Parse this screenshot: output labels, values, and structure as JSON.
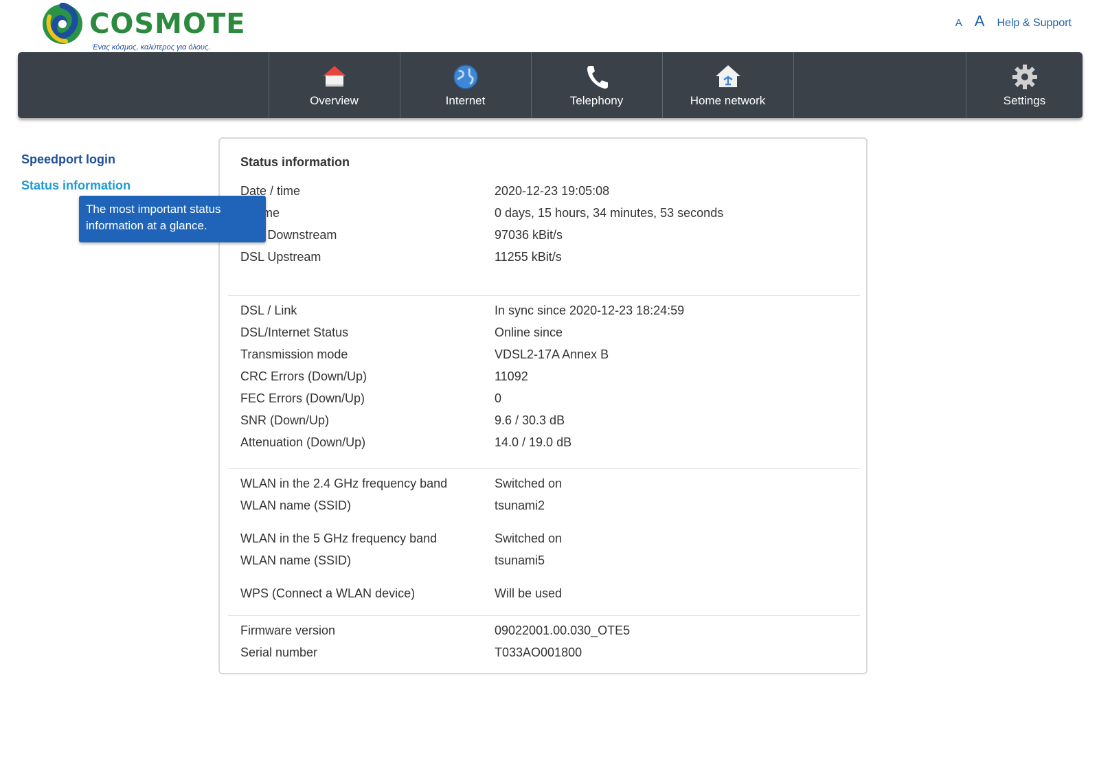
{
  "brand": {
    "name": "COSMOTE",
    "tagline": "Ένας κόσμος, καλύτερος για όλους."
  },
  "top_links": {
    "font_small": "A",
    "font_large": "A",
    "help": "Help & Support"
  },
  "nav": {
    "overview": "Overview",
    "internet": "Internet",
    "telephony": "Telephony",
    "home_network": "Home network",
    "settings": "Settings"
  },
  "sidebar": {
    "login": "Speedport login",
    "status": "Status information",
    "tooltip": "The most important status information at a glance."
  },
  "panel": {
    "title": "Status information",
    "rows": [
      {
        "label": "Date / time",
        "value": "2020-12-23 19:05:08"
      },
      {
        "label": "Uptime",
        "value": "0 days, 15 hours, 34 minutes, 53 seconds"
      },
      {
        "label": "DSL Downstream",
        "value": "97036 kBit/s"
      },
      {
        "label": "DSL Upstream",
        "value": "11255 kBit/s"
      },
      {
        "label": "DSL / Link",
        "value": "In sync since 2020-12-23 18:24:59"
      },
      {
        "label": "DSL/Internet Status",
        "value": "Online since"
      },
      {
        "label": "Transmission mode",
        "value": "VDSL2-17A Annex B"
      },
      {
        "label": "CRC Errors (Down/Up)",
        "value": "11092"
      },
      {
        "label": "FEC Errors (Down/Up)",
        "value": "0"
      },
      {
        "label": "SNR (Down/Up)",
        "value": "9.6 / 30.3 dB"
      },
      {
        "label": "Attenuation (Down/Up)",
        "value": "14.0 / 19.0 dB"
      },
      {
        "label": "WLAN in the 2.4 GHz frequency band",
        "value": "Switched on"
      },
      {
        "label": "WLAN name (SSID)",
        "value": "tsunami2"
      },
      {
        "label": "WLAN in the 5 GHz frequency band",
        "value": "Switched on"
      },
      {
        "label": "WLAN name (SSID)",
        "value": "tsunami5"
      },
      {
        "label": "WPS (Connect a WLAN device)",
        "value": "Will be used"
      },
      {
        "label": "Firmware version",
        "value": "09022001.00.030_OTE5"
      },
      {
        "label": "Serial number",
        "value": "T033AO001800"
      }
    ]
  },
  "colors": {
    "navbar": "#3a4148",
    "link_dark": "#1f4f9a",
    "link_active": "#1e9ad6",
    "tooltip": "#1f64b8",
    "brand_green": "#2c8a3f"
  }
}
